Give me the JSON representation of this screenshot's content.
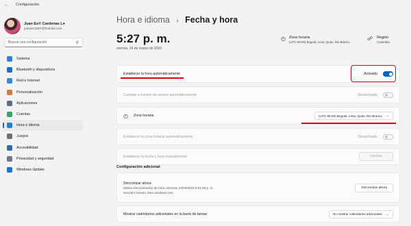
{
  "window": {
    "title": "Configuración"
  },
  "user": {
    "name": "Juan Es© Cardenas L●",
    "email": "juanesc2007@hotmail.com"
  },
  "search": {
    "placeholder": "Buscar una configuración"
  },
  "sidebar": {
    "items": [
      {
        "label": "Sistema",
        "icon": "system-icon",
        "color": "#2f80d0"
      },
      {
        "label": "Bluetooth y dispositivos",
        "icon": "bluetooth-icon",
        "color": "#1a6fc4"
      },
      {
        "label": "Red e Internet",
        "icon": "wifi-icon",
        "color": "#3b86d6"
      },
      {
        "label": "Personalización",
        "icon": "brush-icon",
        "color": "#d27a3a"
      },
      {
        "label": "Aplicaciones",
        "icon": "apps-icon",
        "color": "#5c6f8a"
      },
      {
        "label": "Cuentas",
        "icon": "person-icon",
        "color": "#36a56b"
      },
      {
        "label": "Hora e idioma",
        "icon": "globe-clock-icon",
        "color": "#2a7fc9"
      },
      {
        "label": "Juegos",
        "icon": "gamepad-icon",
        "color": "#6f6f6f"
      },
      {
        "label": "Accesibilidad",
        "icon": "accessibility-icon",
        "color": "#2b6cb0"
      },
      {
        "label": "Privacidad y seguridad",
        "icon": "shield-icon",
        "color": "#6e7a89"
      },
      {
        "label": "Windows Update",
        "icon": "update-icon",
        "color": "#1d73c9"
      }
    ],
    "active_index": 6
  },
  "breadcrumb": {
    "parent": "Hora e idioma",
    "separator": "›",
    "current": "Fecha y hora"
  },
  "clock": {
    "time": "5:27 p. m.",
    "date": "viernes, 24 de marzo de 2023"
  },
  "timezone_info": {
    "label": "Zona horaria",
    "value": "(UTC-05:00) Bogotá, Lima, Quito, Rio Branco"
  },
  "region_info": {
    "label": "Región",
    "value": "Colombia"
  },
  "settings": {
    "auto_time": {
      "label": "Establecer la hora automáticamente",
      "status": "Activado"
    },
    "dst": {
      "label": "Cambiar a horario de verano automáticamente",
      "status": "Desactivado"
    },
    "timezone": {
      "label": "Zona horaria",
      "value": "(UTC-05:00) Bogotá, Lima, Quito, Rio Branco"
    },
    "auto_tz": {
      "label": "Establecer la zona horaria automáticamente",
      "status": "Desactivado"
    },
    "manual": {
      "label": "Establecer la fecha y hora manualmente",
      "button": "Cambiar"
    }
  },
  "additional": {
    "title": "Configuración adicional",
    "sync_title": "Sincronizar ahora",
    "sync_last": "Última sincronización de hora correcta: 24/03/2023 5:01:59 p. m.",
    "sync_server": "Servidor horario: time.windows.com",
    "sync_button": "Sincronizar ahora",
    "calendars_label": "Mostrar calendarios adicionales en la barra de tareas",
    "calendars_value": "No mostrar calendarios adicionales"
  },
  "colors": {
    "accent": "#0067c0",
    "highlight": "#e0001a"
  }
}
